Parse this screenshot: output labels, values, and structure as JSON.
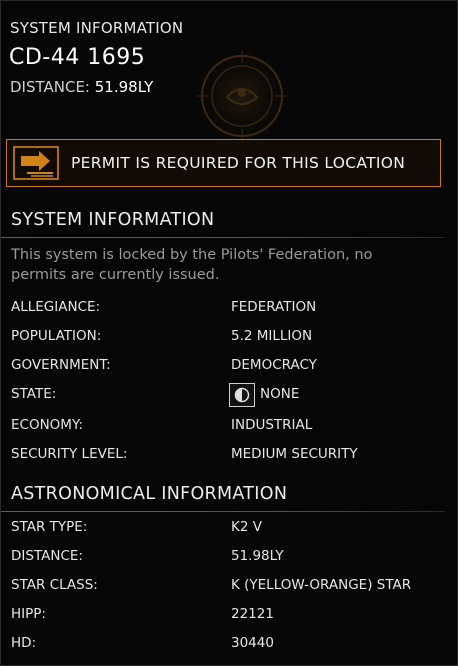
{
  "header": {
    "title": "SYSTEM INFORMATION",
    "system_name": "CD-44 1695",
    "distance_label": "DISTANCE:",
    "distance_value": "51.98LY"
  },
  "permit": {
    "message": "PERMIT IS REQUIRED FOR THIS LOCATION",
    "icon": "permit-arrow-icon"
  },
  "system_info": {
    "heading": "SYSTEM INFORMATION",
    "description": "This system is locked by the Pilots' Federation, no permits are currently issued.",
    "rows": [
      {
        "label": "ALLEGIANCE:",
        "value": "FEDERATION"
      },
      {
        "label": "POPULATION:",
        "value": "5.2 MILLION"
      },
      {
        "label": "GOVERNMENT:",
        "value": "DEMOCRACY"
      },
      {
        "label": "STATE:",
        "value": "NONE"
      },
      {
        "label": "ECONOMY:",
        "value": "INDUSTRIAL"
      },
      {
        "label": "SECURITY LEVEL:",
        "value": "MEDIUM SECURITY"
      }
    ]
  },
  "astro_info": {
    "heading": "ASTRONOMICAL INFORMATION",
    "rows": [
      {
        "label": "STAR TYPE:",
        "value": "K2 V"
      },
      {
        "label": "DISTANCE:",
        "value": "51.98LY"
      },
      {
        "label": "STAR CLASS:",
        "value": "K (YELLOW-ORANGE) STAR"
      },
      {
        "label": "HIPP:",
        "value": "22121"
      },
      {
        "label": "HD:",
        "value": "30440"
      }
    ]
  },
  "colors": {
    "accent": "#c97b12",
    "background": "#050505",
    "text": "#e6e6e6",
    "muted_text": "#9a9a9a"
  }
}
